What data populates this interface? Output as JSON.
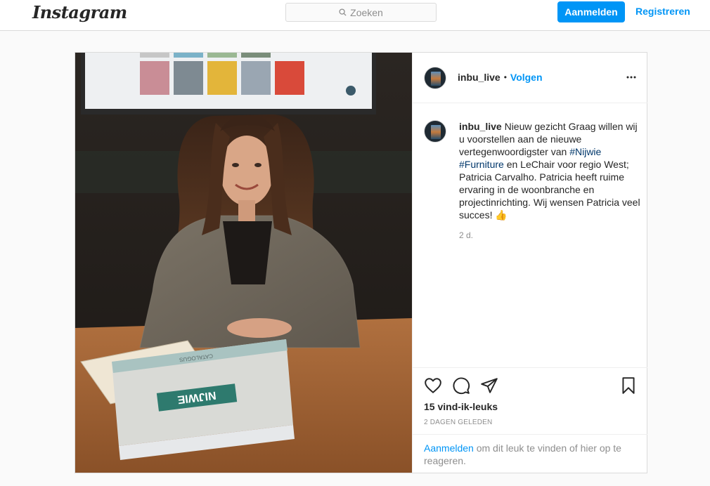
{
  "topbar": {
    "logo": "Instagram",
    "search_placeholder": "Zoeken",
    "login_label": "Aanmelden",
    "register_label": "Registreren"
  },
  "post": {
    "username": "inbu_live",
    "separator": "•",
    "follow_label": "Volgen",
    "caption": {
      "username": "inbu_live",
      "text_1": " Nieuw gezicht Graag willen wij u voorstellen aan de nieuwe vertegenwoordigster van ",
      "hashtag_1": "#Nijwie",
      "hashtag_2": "#Furniture",
      "text_2": " en LeChair voor regio West; Patricia Carvalho. Patricia heeft ruime ervaring in de woonbranche en projectinrichting. Wij wensen Patricia veel succes! ",
      "emoji": "👍"
    },
    "time_short": "2 d.",
    "likes": "15 vind-ik-leuks",
    "date_long": "2 DAGEN GELEDEN",
    "login_prompt": {
      "link": "Aanmelden",
      "text": " om dit leuk te vinden of hier op te reageren."
    },
    "photo_binder_text": "NIJWIE",
    "photo_binder_spine": "CATALOGUS"
  },
  "colors": {
    "accent": "#0095f6",
    "hashtag": "#00376b",
    "muted": "#8e8e8e",
    "border": "#dbdbdb"
  },
  "icons": [
    "search-icon",
    "more-options-icon",
    "heart-icon",
    "comment-icon",
    "share-icon",
    "bookmark-icon"
  ]
}
